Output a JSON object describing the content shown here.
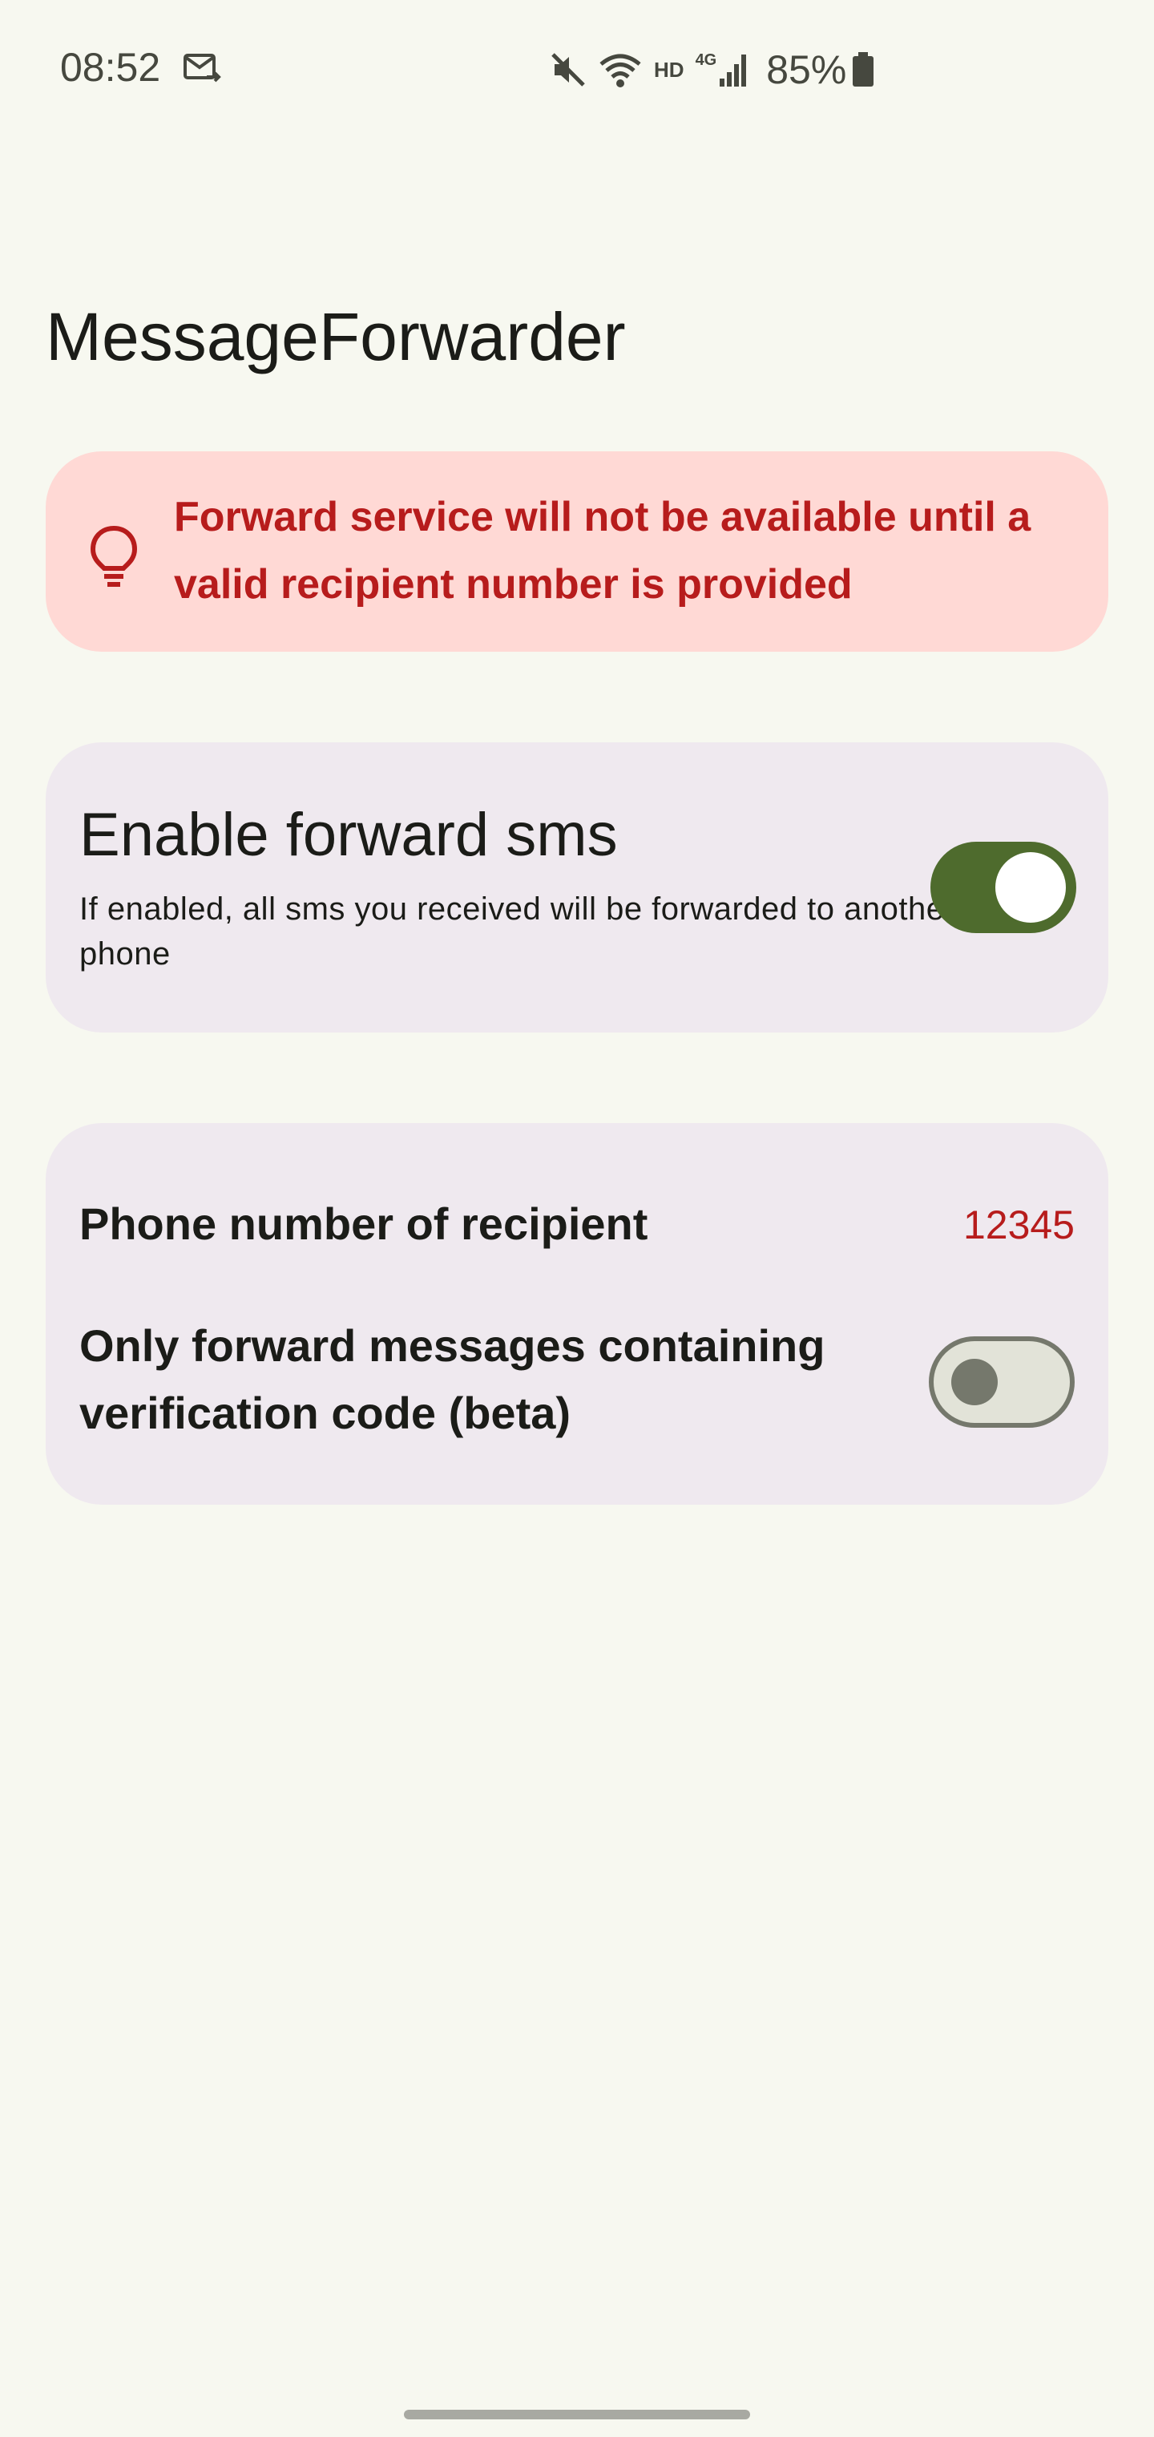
{
  "status_bar": {
    "time": "08:52",
    "battery": "85%",
    "network_label": "HD",
    "network_type": "4G",
    "icons": [
      "mail-icon",
      "mute-icon",
      "wifi-icon",
      "signal-icon",
      "battery-icon"
    ]
  },
  "app": {
    "title": "MessageForwarder"
  },
  "warning": {
    "icon": "lightbulb-icon",
    "text": "Forward service will not be available until a valid recipient number is provided",
    "color": "#b71c1c",
    "background": "#ffd9d5"
  },
  "enable_forward": {
    "title": "Enable forward sms",
    "description": "If enabled, all sms you received will be forwarded to another phone",
    "enabled": true
  },
  "settings": {
    "recipient_label": "Phone number of recipient",
    "recipient_value": "12345",
    "verification_label": "Only forward messages containing verification code (beta)",
    "verification_enabled": false
  },
  "colors": {
    "background": "#f7f8f0",
    "card": "#efe9ef",
    "switch_on": "#4e6b2d",
    "switch_off_track": "#e2e3d8",
    "switch_off_outline": "#75786c",
    "error": "#b71c1c"
  }
}
